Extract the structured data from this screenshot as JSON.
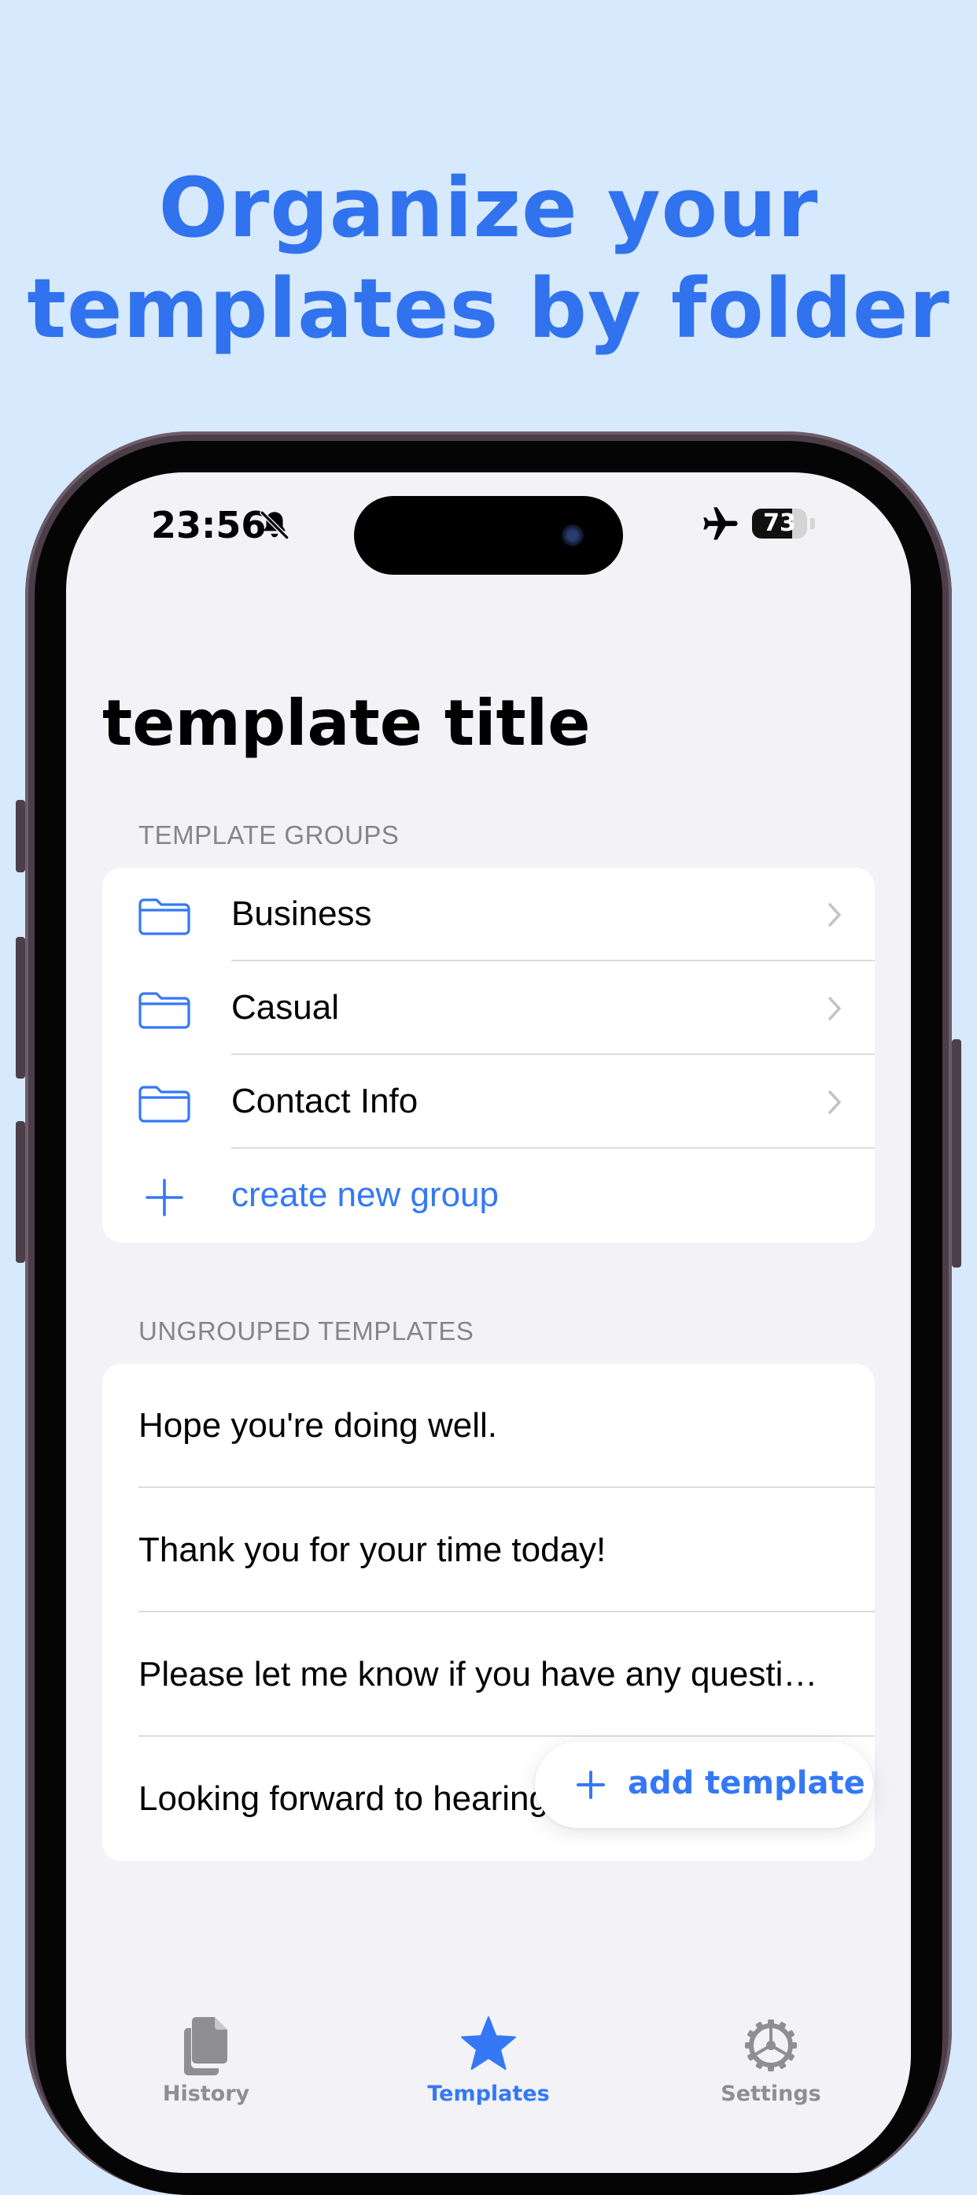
{
  "promo": {
    "headline_line1": "Organize your",
    "headline_line2": "templates by folder"
  },
  "status_bar": {
    "time": "23:56",
    "battery_percent": 73,
    "silent_mode": true,
    "airplane_mode": true
  },
  "page": {
    "title": "template title"
  },
  "template_groups": {
    "header": "TEMPLATE GROUPS",
    "items": [
      {
        "label": "Business",
        "icon": "folder-icon"
      },
      {
        "label": "Casual",
        "icon": "folder-icon"
      },
      {
        "label": "Contact Info",
        "icon": "folder-icon"
      }
    ],
    "create_label": "create new group"
  },
  "ungrouped": {
    "header": "UNGROUPED TEMPLATES",
    "items": [
      "Hope you're doing well.",
      "Thank you for your time today!",
      "Please let me know if you have any questi…",
      "Looking forward to hearing from you."
    ]
  },
  "fab": {
    "label": "add template"
  },
  "tabbar": {
    "tabs": [
      {
        "label": "History",
        "icon": "document-icon",
        "active": false
      },
      {
        "label": "Templates",
        "icon": "star-icon",
        "active": true
      },
      {
        "label": "Settings",
        "icon": "gear-icon",
        "active": false
      }
    ]
  },
  "colors": {
    "accent": "#3478f6",
    "headline": "#3172ee",
    "background": "#d7e9fc",
    "screen_background": "#f2f2f7",
    "inactive_tab": "#8e8e93"
  }
}
